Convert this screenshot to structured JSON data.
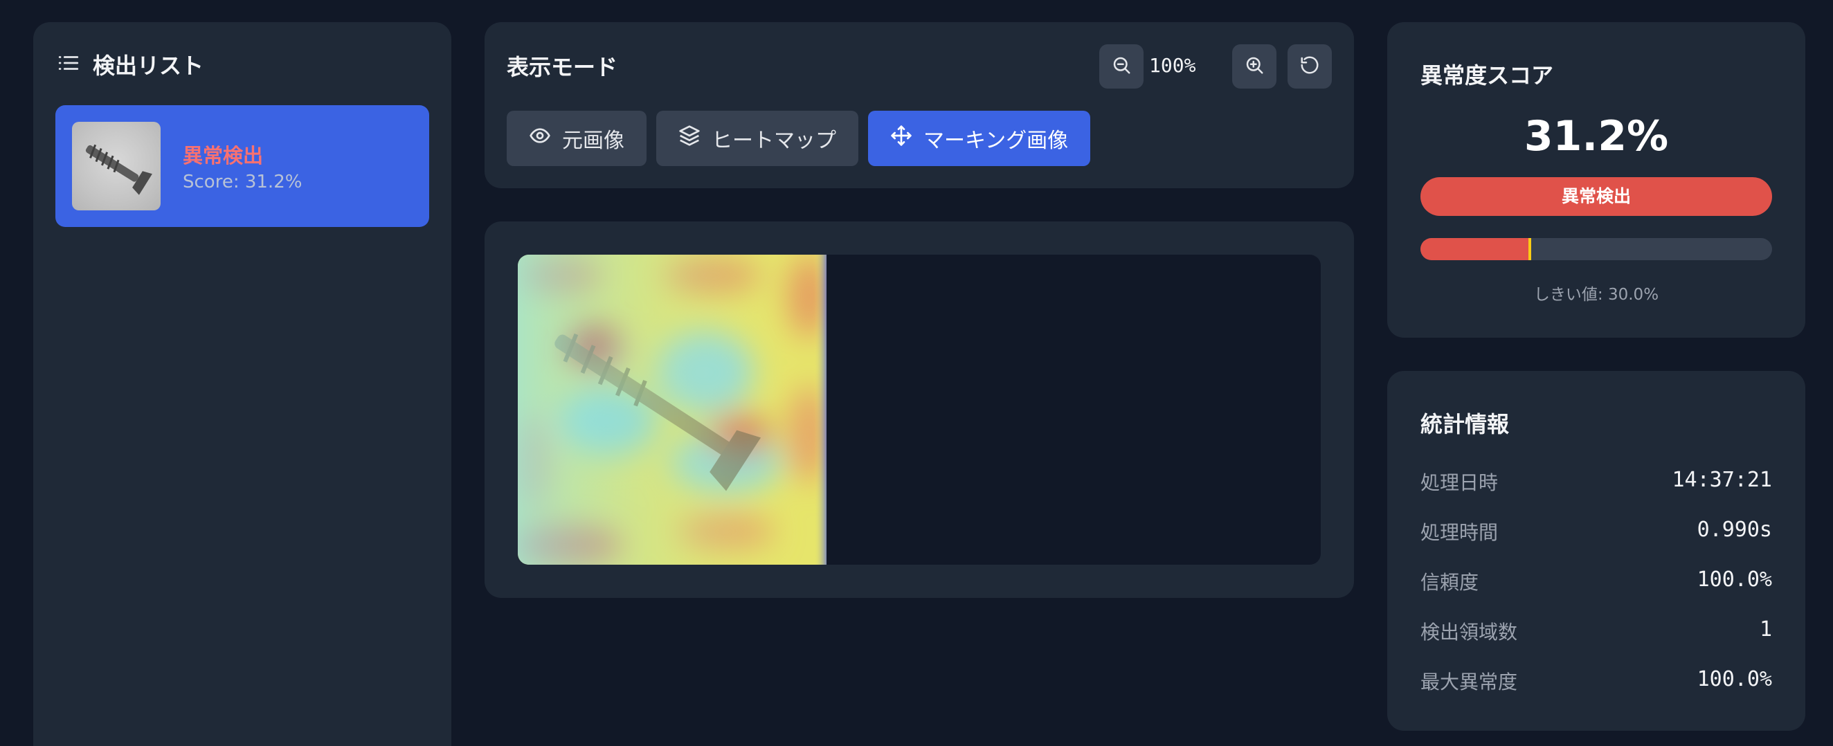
{
  "detection_list": {
    "title": "検出リスト",
    "items": [
      {
        "status": "異常検出",
        "score": "Score: 31.2%"
      }
    ]
  },
  "display_mode": {
    "title": "表示モード",
    "zoom": "100%",
    "modes": [
      {
        "label": "元画像",
        "icon": "eye-icon"
      },
      {
        "label": "ヒートマップ",
        "icon": "layers-icon"
      },
      {
        "label": "マーキング画像",
        "icon": "move-icon"
      }
    ],
    "active_mode": "マーキング画像"
  },
  "anomaly_score": {
    "title": "異常度スコア",
    "value": "31.2%",
    "fraction": 0.312,
    "status": "異常検出",
    "threshold_fraction": 0.3,
    "threshold_label": "しきい値: 30.0%"
  },
  "statistics": {
    "title": "統計情報",
    "rows": [
      {
        "label": "処理日時",
        "value": "14:37:21"
      },
      {
        "label": "処理時間",
        "value": "0.990s"
      },
      {
        "label": "信頼度",
        "value": "100.0%"
      },
      {
        "label": "検出領域数",
        "value": "1"
      },
      {
        "label": "最大異常度",
        "value": "100.0%"
      }
    ]
  },
  "colors": {
    "accent": "#3b63e3",
    "danger": "#e0524a",
    "threshold_marker": "#facc15"
  }
}
